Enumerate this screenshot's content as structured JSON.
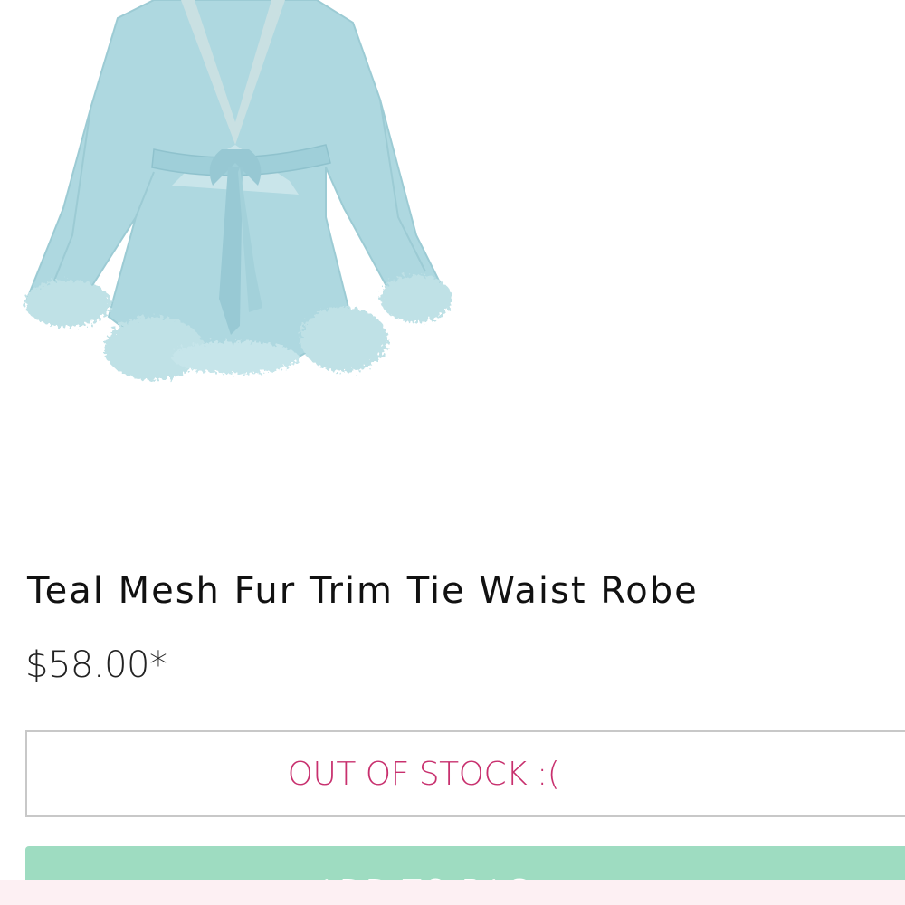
{
  "product": {
    "image_alt": "Teal Mesh Fur Trim Tie Waist Robe",
    "title": "Teal Mesh Fur Trim Tie Waist Robe",
    "price": "$58.00*",
    "stock_status": "OUT OF STOCK :(",
    "add_to_bag_label": "ADD TO BAG"
  },
  "colors": {
    "robe_teal": "#a9d8e0",
    "stock_text": "#c8306e",
    "add_button_bg": "#9edcc1",
    "bottom_bar_bg": "#fdf0f3"
  },
  "icons": {
    "product_photo": "robe-image"
  }
}
